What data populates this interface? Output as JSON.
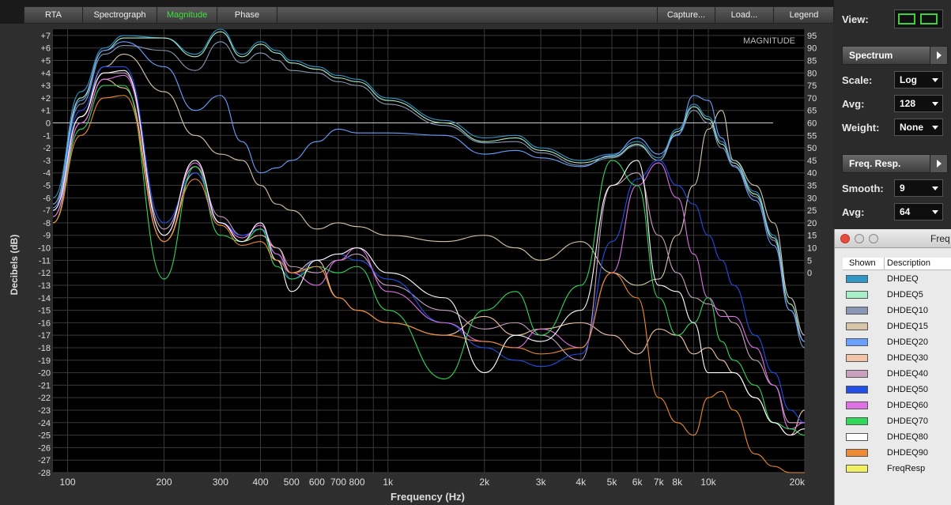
{
  "tabs": {
    "rta": "RTA",
    "spectrograph": "Spectrograph",
    "magnitude": "Magnitude",
    "phase": "Phase",
    "capture": "Capture...",
    "load": "Load...",
    "legend": "Legend"
  },
  "plot": {
    "tag": "MAGNITUDE",
    "xlabel": "Frequency (Hz)",
    "ylabel": "Decibels (dB)",
    "x_ticks": [
      "100",
      "200",
      "300",
      "400",
      "500",
      "600",
      "700",
      "800",
      "1k",
      "2k",
      "3k",
      "4k",
      "5k",
      "6k",
      "7k",
      "8k",
      "10k",
      "20k"
    ],
    "x_tick_values": [
      100,
      200,
      300,
      400,
      500,
      600,
      700,
      800,
      1000,
      2000,
      3000,
      4000,
      5000,
      6000,
      7000,
      8000,
      10000,
      20000
    ],
    "y_ticks": [
      "+7",
      "+6",
      "+5",
      "+4",
      "+3",
      "+2",
      "+1",
      "0",
      "-1",
      "-2",
      "-3",
      "-4",
      "-5",
      "-6",
      "-7",
      "-8",
      "-9",
      "-10",
      "-11",
      "-12",
      "-13",
      "-14",
      "-15",
      "-16",
      "-17",
      "-18",
      "-19",
      "-20",
      "-21",
      "-22",
      "-23",
      "-24",
      "-25",
      "-26",
      "-27",
      "-28"
    ],
    "right_ticks": [
      "95",
      "90",
      "85",
      "80",
      "75",
      "70",
      "65",
      "60",
      "55",
      "50",
      "45",
      "40",
      "35",
      "30",
      "25",
      "20",
      "15",
      "10",
      "5",
      "0"
    ],
    "colors": {
      "background": "#000000",
      "grid": "#3a3a3a",
      "zero": "#cccccc",
      "frame": "#2e2e2e"
    }
  },
  "chart_data": {
    "type": "line",
    "title": "MAGNITUDE",
    "xlabel": "Frequency (Hz)",
    "ylabel": "Decibels (dB)",
    "xscale": "log",
    "xlim": [
      90,
      20000
    ],
    "ylim": [
      -28,
      7.5
    ],
    "grid": true,
    "series": [
      {
        "name": "DHDEQ",
        "color": "#2f98c9",
        "x": [
          90,
          110,
          130,
          150,
          200,
          250,
          300,
          350,
          400,
          450,
          500,
          600,
          700,
          800,
          1000,
          1500,
          2000,
          2500,
          3000,
          4000,
          5000,
          6000,
          7000,
          8000,
          9000,
          10000,
          11000,
          12000,
          14000,
          16000,
          18000,
          20000
        ],
        "y": [
          -6,
          2.5,
          6,
          7,
          6.8,
          5.5,
          7.5,
          5.5,
          6.5,
          5.8,
          5,
          4.5,
          3.8,
          3.5,
          2,
          0.2,
          -1.2,
          -1,
          -2,
          -3,
          -2.5,
          -1.5,
          -2.8,
          -0.5,
          1.5,
          0.5,
          -1.5,
          -3,
          -5.5,
          -9,
          -14,
          -17
        ]
      },
      {
        "name": "DHDEQ5",
        "color": "#a8f0c8",
        "x": [
          90,
          110,
          130,
          150,
          200,
          250,
          300,
          350,
          400,
          450,
          500,
          600,
          700,
          800,
          1000,
          1500,
          2000,
          2500,
          3000,
          4000,
          5000,
          6000,
          7000,
          8000,
          9000,
          10000,
          11000,
          12000,
          14000,
          16000,
          18000,
          20000
        ],
        "y": [
          -6.5,
          2,
          5.8,
          6.8,
          6.8,
          5.3,
          7.3,
          5.3,
          6.3,
          5.6,
          4.8,
          4.3,
          3.6,
          3.3,
          1.8,
          0,
          -1.5,
          -1.2,
          -2.2,
          -3.2,
          -2.7,
          -1.7,
          -3,
          -0.7,
          1.3,
          0.3,
          -1.7,
          -3.2,
          -5.7,
          -9.2,
          -14.5,
          -17.5
        ]
      },
      {
        "name": "DHDEQ10",
        "color": "#8898b4",
        "x": [
          90,
          110,
          130,
          150,
          200,
          250,
          300,
          350,
          400,
          450,
          500,
          600,
          700,
          800,
          1000,
          1500,
          2000,
          2500,
          3000,
          4000,
          5000,
          6000,
          7000,
          8000,
          9000,
          10000,
          11000,
          12000,
          14000,
          16000,
          18000,
          20000
        ],
        "y": [
          -6.5,
          1.5,
          5.5,
          6.2,
          5.8,
          4.2,
          6.5,
          4.8,
          5.6,
          5,
          4.2,
          4,
          3.3,
          3,
          1.5,
          -0.2,
          -1.6,
          -1.5,
          -2.4,
          -3.4,
          -2.8,
          -1.8,
          -3,
          -0.9,
          1,
          0,
          -2,
          -3.4,
          -5.9,
          -9.4,
          -15,
          -18
        ]
      },
      {
        "name": "DHDEQ15",
        "color": "#d8c4a8",
        "x": [
          90,
          110,
          130,
          150,
          200,
          250,
          300,
          350,
          400,
          450,
          500,
          600,
          700,
          800,
          1000,
          1500,
          2000,
          2500,
          3000,
          4000,
          5000,
          6000,
          7000,
          8000,
          9000,
          10000,
          11000,
          12000,
          14000,
          16000,
          18000,
          20000
        ],
        "y": [
          -7,
          0.5,
          4.5,
          5.5,
          2.5,
          -1,
          -2.5,
          -3,
          -5,
          -6.5,
          -7,
          -8.5,
          -8,
          -8.3,
          -9,
          -9.5,
          -9,
          -10,
          -11,
          -9.5,
          -12,
          -13,
          -12.5,
          -9,
          -5,
          -0.5,
          1,
          -3,
          -5,
          -8,
          -14,
          -17
        ]
      },
      {
        "name": "DHDEQ20",
        "color": "#6aa0ff",
        "x": [
          90,
          110,
          130,
          150,
          200,
          250,
          300,
          350,
          400,
          450,
          500,
          600,
          700,
          800,
          1000,
          1500,
          2000,
          2500,
          3000,
          4000,
          5000,
          6000,
          7000,
          8000,
          9000,
          10000,
          11000,
          12000,
          14000,
          16000,
          18000,
          20000
        ],
        "y": [
          -6.8,
          1.8,
          5.8,
          6.5,
          4.5,
          1,
          2.2,
          -1.5,
          -4,
          -3.6,
          -3,
          -1.5,
          -0.5,
          -0.8,
          -0.8,
          -1,
          -2.5,
          -2.2,
          -2.8,
          -3.5,
          -2.6,
          -1.2,
          -2.5,
          -1,
          2.2,
          1.8,
          -1.2,
          -3.5,
          -6.2,
          -9.8,
          -15,
          -17.5
        ]
      },
      {
        "name": "DHDEQ30",
        "color": "#f4c4a8",
        "x": [
          90,
          110,
          130,
          150,
          200,
          250,
          300,
          350,
          400,
          450,
          500,
          600,
          700,
          800,
          1000,
          1500,
          2000,
          2500,
          3000,
          4000,
          5000,
          6000,
          7000,
          8000,
          9000,
          10000,
          11000,
          12000,
          14000,
          16000,
          18000,
          20000
        ],
        "y": [
          -8,
          0,
          3.5,
          2.8,
          -9.5,
          -4,
          -8,
          -9.5,
          -9,
          -10,
          -12,
          -11,
          -14,
          -15,
          -16,
          -17,
          -15.5,
          -17,
          -16.5,
          -16,
          -17,
          -18.5,
          -16.5,
          -17,
          -18.5,
          -18,
          -19,
          -20,
          -22,
          -24,
          -25,
          -23
        ]
      },
      {
        "name": "DHDEQ40",
        "color": "#c8a0c0",
        "x": [
          90,
          110,
          130,
          150,
          200,
          250,
          300,
          350,
          400,
          450,
          500,
          600,
          700,
          800,
          1000,
          1500,
          2000,
          2500,
          3000,
          4000,
          5000,
          6000,
          7000,
          8000,
          9000,
          10000,
          11000,
          12000,
          14000,
          16000,
          18000,
          20000
        ],
        "y": [
          -7.5,
          0.5,
          4,
          4,
          -8.5,
          -3.5,
          -7.5,
          -9,
          -8.5,
          -10,
          -11.5,
          -12,
          -11,
          -10.5,
          -13,
          -15,
          -16.5,
          -16,
          -17,
          -19,
          -5,
          -4,
          -9,
          -12,
          -14,
          -14.5,
          -15,
          -16,
          -19,
          -21,
          -24,
          -24
        ]
      },
      {
        "name": "DHDEQ50",
        "color": "#1f4fe8",
        "x": [
          90,
          110,
          130,
          150,
          200,
          250,
          300,
          350,
          400,
          450,
          500,
          600,
          700,
          800,
          1000,
          1500,
          2000,
          2500,
          3000,
          4000,
          5000,
          6000,
          7000,
          8000,
          9000,
          10000,
          11000,
          12000,
          14000,
          16000,
          18000,
          20000
        ],
        "y": [
          -7,
          1,
          4.5,
          4.5,
          -8,
          -4,
          -8,
          -9,
          -8.5,
          -10.5,
          -12.5,
          -11,
          -10.5,
          -11,
          -12.5,
          -16,
          -18,
          -19,
          -19.5,
          -18.5,
          -9.5,
          -4.5,
          -3,
          -5,
          -6.5,
          -9,
          -11,
          -13,
          -17,
          -20,
          -23,
          -24
        ]
      },
      {
        "name": "DHDEQ60",
        "color": "#e070e8",
        "x": [
          90,
          110,
          130,
          150,
          200,
          250,
          300,
          350,
          400,
          450,
          500,
          600,
          700,
          800,
          1000,
          1500,
          2000,
          2500,
          3000,
          4000,
          5000,
          6000,
          7000,
          8000,
          9000,
          10000,
          11000,
          12000,
          14000,
          16000,
          18000,
          20000
        ],
        "y": [
          -7.5,
          0,
          3.5,
          3.8,
          -9,
          -3.2,
          -8,
          -9.2,
          -8.2,
          -10.5,
          -12,
          -13,
          -11,
          -10,
          -13.5,
          -16,
          -17.5,
          -18,
          -16.5,
          -18,
          -12,
          -5,
          -3.2,
          -6,
          -10.5,
          -14,
          -15.5,
          -15.5,
          -18,
          -21,
          -24.5,
          -24
        ]
      },
      {
        "name": "DHDEQ70",
        "color": "#2fd858",
        "x": [
          90,
          110,
          130,
          150,
          200,
          250,
          300,
          350,
          400,
          450,
          500,
          600,
          700,
          800,
          1000,
          1500,
          2000,
          2500,
          3000,
          4000,
          5000,
          6000,
          7000,
          8000,
          9000,
          10000,
          11000,
          12000,
          14000,
          16000,
          18000,
          20000
        ],
        "y": [
          -8,
          -0.5,
          3,
          3,
          -12.5,
          -3.5,
          -9,
          -9.5,
          -8.5,
          -11.5,
          -12.5,
          -11.5,
          -12,
          -11.5,
          -15,
          -20.5,
          -15,
          -13.5,
          -17,
          -13,
          -3,
          -5,
          -14,
          -17,
          -16,
          -14,
          -17.5,
          -19,
          -21,
          -24,
          -24.5,
          -25
        ]
      },
      {
        "name": "DHDEQ80",
        "color": "#ffffff",
        "x": [
          90,
          110,
          130,
          150,
          200,
          250,
          300,
          350,
          400,
          450,
          500,
          600,
          700,
          800,
          1000,
          1500,
          2000,
          2500,
          3000,
          4000,
          5000,
          6000,
          7000,
          8000,
          9000,
          10000,
          11000,
          12000,
          14000,
          16000,
          18000,
          20000
        ],
        "y": [
          -7,
          0.5,
          4,
          4.2,
          -9,
          -3,
          -8,
          -9.5,
          -8,
          -11,
          -13.5,
          -11,
          -10.5,
          -10,
          -12,
          -14,
          -20,
          -17,
          -17.5,
          -15,
          -5,
          -3,
          -13,
          -13.5,
          -16,
          -20,
          -20,
          -20,
          -22,
          -24,
          -25,
          -24.5
        ]
      },
      {
        "name": "DHDEQ90",
        "color": "#f08a30",
        "x": [
          90,
          110,
          130,
          150,
          200,
          250,
          300,
          350,
          400,
          450,
          500,
          600,
          700,
          800,
          1000,
          1500,
          2000,
          2500,
          3000,
          4000,
          5000,
          6000,
          7000,
          8000,
          9000,
          10000,
          11000,
          12000,
          14000,
          16000,
          18000,
          20000
        ],
        "y": [
          -8,
          -1,
          2,
          2.2,
          -9.5,
          -4.5,
          -8.2,
          -9.8,
          -9.5,
          -11,
          -12,
          -11.5,
          -14,
          -15,
          -16,
          -17,
          -17.5,
          -18,
          -18.5,
          -18,
          -12,
          -14,
          -22,
          -24,
          -25,
          -22,
          -21.5,
          -23,
          -26.5,
          -27.5,
          -28,
          -28
        ]
      },
      {
        "name": "FreqResp",
        "color": "#f0f060",
        "x": [],
        "y": []
      }
    ]
  },
  "panel": {
    "view_label": "View:",
    "spectrum_header": "Spectrum",
    "scale_label": "Scale:",
    "scale_value": "Log",
    "avg_label": "Avg:",
    "avg_value": "128",
    "weight_label": "Weight:",
    "weight_value": "None",
    "freqresp_header": "Freq. Resp.",
    "smooth_label": "Smooth:",
    "smooth_value": "9",
    "avg2_label": "Avg:",
    "avg2_value": "64"
  },
  "legend": {
    "title": "Freq",
    "col_shown": "Shown",
    "col_desc": "Description",
    "items": [
      {
        "name": "DHDEQ",
        "color": "#2f98c9"
      },
      {
        "name": "DHDEQ5",
        "color": "#a8f0c8"
      },
      {
        "name": "DHDEQ10",
        "color": "#8898b4"
      },
      {
        "name": "DHDEQ15",
        "color": "#d8c4a8"
      },
      {
        "name": "DHDEQ20",
        "color": "#6aa0ff"
      },
      {
        "name": "DHDEQ30",
        "color": "#f4c4a8"
      },
      {
        "name": "DHDEQ40",
        "color": "#c8a0c0"
      },
      {
        "name": "DHDEQ50",
        "color": "#1f4fe8"
      },
      {
        "name": "DHDEQ60",
        "color": "#e070e8"
      },
      {
        "name": "DHDEQ70",
        "color": "#2fd858"
      },
      {
        "name": "DHDEQ80",
        "color": "#ffffff"
      },
      {
        "name": "DHDEQ90",
        "color": "#f08a30"
      },
      {
        "name": "FreqResp",
        "color": "#f0f060"
      }
    ]
  }
}
